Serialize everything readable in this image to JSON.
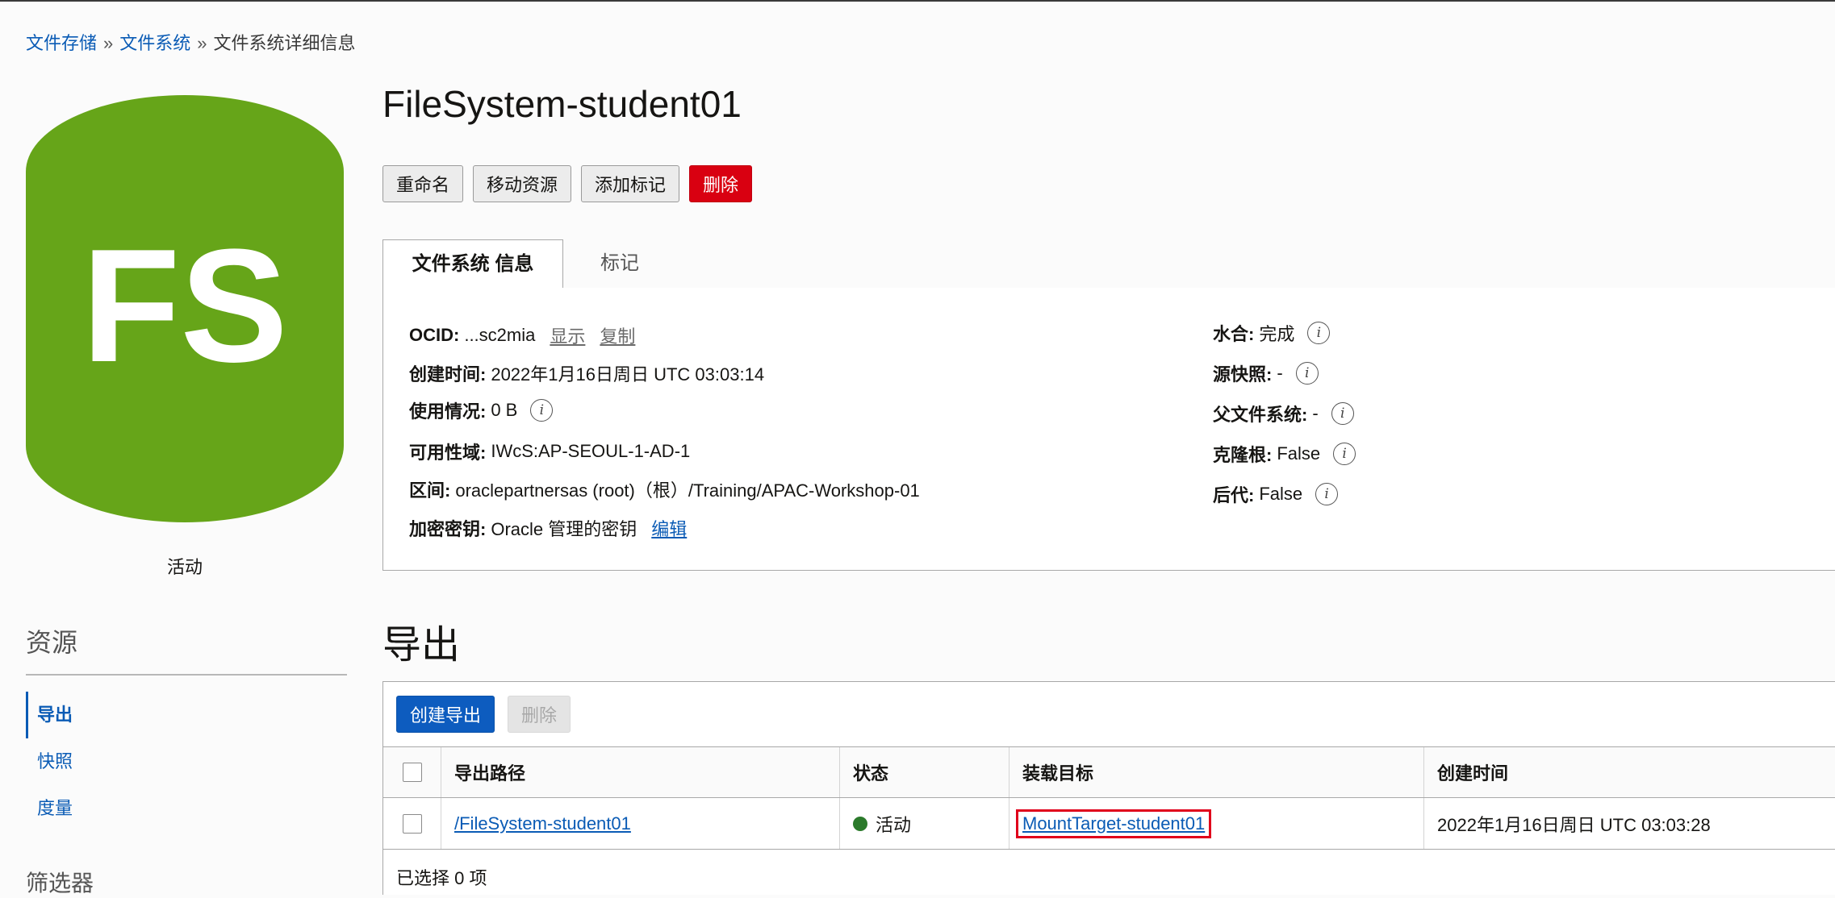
{
  "breadcrumb": {
    "items": [
      "文件存储",
      "文件系统"
    ],
    "separator": "»",
    "current": "文件系统详细信息"
  },
  "logo": {
    "text": "FS",
    "color": "#66a519"
  },
  "status": "活动",
  "title": "FileSystem-student01",
  "actions": {
    "rename": "重命名",
    "move": "移动资源",
    "add_tags": "添加标记",
    "delete": "删除"
  },
  "tabs": {
    "info": "文件系统 信息",
    "tags": "标记"
  },
  "info": {
    "ocid_label": "OCID:",
    "ocid_value": "...sc2mia",
    "ocid_show": "显示",
    "ocid_copy": "复制",
    "created_label": "创建时间:",
    "created_value": "2022年1月16日周日 UTC 03:03:14",
    "usage_label": "使用情况:",
    "usage_value": "0 B",
    "ad_label": "可用性域:",
    "ad_value": "IWcS:AP-SEOUL-1-AD-1",
    "compartment_label": "区间:",
    "compartment_value": "oraclepartnersas (root)（根）/Training/APAC-Workshop-01",
    "key_label": "加密密钥:",
    "key_value": "Oracle 管理的密钥",
    "key_edit": "编辑",
    "hydrated_label": "水合:",
    "hydrated_value": "完成",
    "source_snapshot_label": "源快照:",
    "source_snapshot_value": "-",
    "parent_fs_label": "父文件系统:",
    "parent_fs_value": "-",
    "clone_root_label": "克隆根:",
    "clone_root_value": "False",
    "descendants_label": "后代:",
    "descendants_value": "False",
    "info_glyph": "i"
  },
  "resources": {
    "title": "资源",
    "items": [
      "导出",
      "快照",
      "度量"
    ],
    "filters_title": "筛选器"
  },
  "exports": {
    "title": "导出",
    "create_button": "创建导出",
    "delete_button": "删除",
    "columns": [
      "导出路径",
      "状态",
      "装载目标",
      "创建时间"
    ],
    "rows": [
      {
        "path": "/FileSystem-student01",
        "status": "活动",
        "mount_target": "MountTarget-student01",
        "created": "2022年1月16日周日 UTC 03:03:28"
      }
    ],
    "selected": "已选择 0 项"
  },
  "colors": {
    "link": "#0a5bb5",
    "danger": "#d90011",
    "primary": "#0d5cbf",
    "active_status": "#2b7a2b",
    "highlight_box": "#e0001b"
  }
}
